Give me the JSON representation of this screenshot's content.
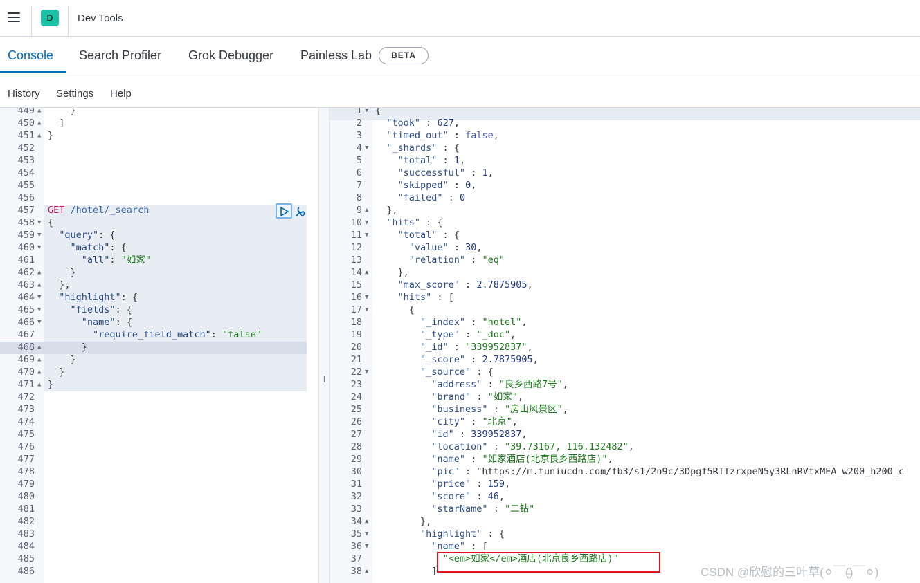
{
  "app": {
    "title": "Dev Tools",
    "space_initial": "D"
  },
  "tabs": [
    {
      "label": "Console",
      "active": true
    },
    {
      "label": "Search Profiler"
    },
    {
      "label": "Grok Debugger"
    },
    {
      "label": "Painless Lab"
    }
  ],
  "beta_label": "BETA",
  "submenu": [
    "History",
    "Settings",
    "Help"
  ],
  "request_lines": [
    {
      "n": "449",
      "fold": "▲",
      "code": "    }"
    },
    {
      "n": "450",
      "fold": "▲",
      "code": "  ]"
    },
    {
      "n": "451",
      "fold": "▲",
      "code": "}"
    },
    {
      "n": "452",
      "fold": "",
      "code": ""
    },
    {
      "n": "453",
      "fold": "",
      "code": ""
    },
    {
      "n": "454",
      "fold": "",
      "code": ""
    },
    {
      "n": "455",
      "fold": "",
      "code": ""
    },
    {
      "n": "456",
      "fold": "",
      "code": ""
    },
    {
      "n": "457",
      "fold": "",
      "code": "GET /hotel/_search"
    },
    {
      "n": "458",
      "fold": "▼",
      "code": "{"
    },
    {
      "n": "459",
      "fold": "▼",
      "code": "  \"query\": {"
    },
    {
      "n": "460",
      "fold": "▼",
      "code": "    \"match\": {"
    },
    {
      "n": "461",
      "fold": "",
      "code": "      \"all\": \"如家\""
    },
    {
      "n": "462",
      "fold": "▲",
      "code": "    }"
    },
    {
      "n": "463",
      "fold": "▲",
      "code": "  },"
    },
    {
      "n": "464",
      "fold": "▼",
      "code": "  \"highlight\": {"
    },
    {
      "n": "465",
      "fold": "▼",
      "code": "    \"fields\": {"
    },
    {
      "n": "466",
      "fold": "▼",
      "code": "      \"name\": {"
    },
    {
      "n": "467",
      "fold": "",
      "code": "        \"require_field_match\": \"false\""
    },
    {
      "n": "468",
      "fold": "▲",
      "code": "      }"
    },
    {
      "n": "469",
      "fold": "▲",
      "code": "    }"
    },
    {
      "n": "470",
      "fold": "▲",
      "code": "  }"
    },
    {
      "n": "471",
      "fold": "▲",
      "code": "}"
    },
    {
      "n": "472",
      "fold": "",
      "code": ""
    },
    {
      "n": "473",
      "fold": "",
      "code": ""
    },
    {
      "n": "474",
      "fold": "",
      "code": ""
    },
    {
      "n": "475",
      "fold": "",
      "code": ""
    },
    {
      "n": "476",
      "fold": "",
      "code": ""
    },
    {
      "n": "477",
      "fold": "",
      "code": ""
    },
    {
      "n": "478",
      "fold": "",
      "code": ""
    },
    {
      "n": "479",
      "fold": "",
      "code": ""
    },
    {
      "n": "480",
      "fold": "",
      "code": ""
    },
    {
      "n": "481",
      "fold": "",
      "code": ""
    },
    {
      "n": "482",
      "fold": "",
      "code": ""
    },
    {
      "n": "483",
      "fold": "",
      "code": ""
    },
    {
      "n": "484",
      "fold": "",
      "code": ""
    },
    {
      "n": "485",
      "fold": "",
      "code": ""
    },
    {
      "n": "486",
      "fold": "",
      "code": ""
    }
  ],
  "response_lines": [
    {
      "n": "1",
      "fold": "▼",
      "code": "{"
    },
    {
      "n": "2",
      "fold": "",
      "code": "  \"took\" : 627,"
    },
    {
      "n": "3",
      "fold": "",
      "code": "  \"timed_out\" : false,"
    },
    {
      "n": "4",
      "fold": "▼",
      "code": "  \"_shards\" : {"
    },
    {
      "n": "5",
      "fold": "",
      "code": "    \"total\" : 1,"
    },
    {
      "n": "6",
      "fold": "",
      "code": "    \"successful\" : 1,"
    },
    {
      "n": "7",
      "fold": "",
      "code": "    \"skipped\" : 0,"
    },
    {
      "n": "8",
      "fold": "",
      "code": "    \"failed\" : 0"
    },
    {
      "n": "9",
      "fold": "▲",
      "code": "  },"
    },
    {
      "n": "10",
      "fold": "▼",
      "code": "  \"hits\" : {"
    },
    {
      "n": "11",
      "fold": "▼",
      "code": "    \"total\" : {"
    },
    {
      "n": "12",
      "fold": "",
      "code": "      \"value\" : 30,"
    },
    {
      "n": "13",
      "fold": "",
      "code": "      \"relation\" : \"eq\""
    },
    {
      "n": "14",
      "fold": "▲",
      "code": "    },"
    },
    {
      "n": "15",
      "fold": "",
      "code": "    \"max_score\" : 2.7875905,"
    },
    {
      "n": "16",
      "fold": "▼",
      "code": "    \"hits\" : ["
    },
    {
      "n": "17",
      "fold": "▼",
      "code": "      {"
    },
    {
      "n": "18",
      "fold": "",
      "code": "        \"_index\" : \"hotel\","
    },
    {
      "n": "19",
      "fold": "",
      "code": "        \"_type\" : \"_doc\","
    },
    {
      "n": "20",
      "fold": "",
      "code": "        \"_id\" : \"339952837\","
    },
    {
      "n": "21",
      "fold": "",
      "code": "        \"_score\" : 2.7875905,"
    },
    {
      "n": "22",
      "fold": "▼",
      "code": "        \"_source\" : {"
    },
    {
      "n": "23",
      "fold": "",
      "code": "          \"address\" : \"良乡西路7号\","
    },
    {
      "n": "24",
      "fold": "",
      "code": "          \"brand\" : \"如家\","
    },
    {
      "n": "25",
      "fold": "",
      "code": "          \"business\" : \"房山风景区\","
    },
    {
      "n": "26",
      "fold": "",
      "code": "          \"city\" : \"北京\","
    },
    {
      "n": "27",
      "fold": "",
      "code": "          \"id\" : 339952837,"
    },
    {
      "n": "28",
      "fold": "",
      "code": "          \"location\" : \"39.73167, 116.132482\","
    },
    {
      "n": "29",
      "fold": "",
      "code": "          \"name\" : \"如家酒店(北京良乡西路店)\","
    },
    {
      "n": "30",
      "fold": "",
      "code": "          \"pic\" : \"https://m.tuniucdn.com/fb3/s1/2n9c/3Dpgf5RTTzrxpeN5y3RLnRVtxMEA_w200_h200_c"
    },
    {
      "n": "31",
      "fold": "",
      "code": "          \"price\" : 159,"
    },
    {
      "n": "32",
      "fold": "",
      "code": "          \"score\" : 46,"
    },
    {
      "n": "33",
      "fold": "",
      "code": "          \"starName\" : \"二钻\""
    },
    {
      "n": "34",
      "fold": "▲",
      "code": "        },"
    },
    {
      "n": "35",
      "fold": "▼",
      "code": "        \"highlight\" : {"
    },
    {
      "n": "36",
      "fold": "▼",
      "code": "          \"name\" : ["
    },
    {
      "n": "37",
      "fold": "",
      "code": "            \"<em>如家</em>酒店(北京良乡西路店)\""
    },
    {
      "n": "38",
      "fold": "▲",
      "code": "          ]"
    }
  ],
  "watermark": "CSDN @欣慰的三叶草(⚪￣(̶)￣⚪)",
  "colors": {
    "accent": "#006bb8",
    "string": "#1b7a1b",
    "method": "#c41a53",
    "highlight_box": "#e0161f"
  }
}
